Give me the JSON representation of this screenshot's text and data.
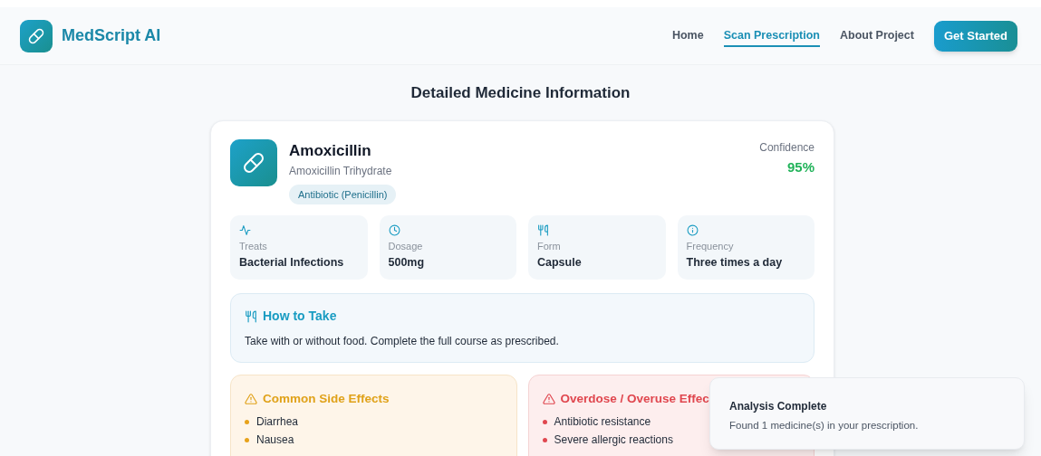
{
  "brand": {
    "name": "MedScript AI"
  },
  "nav": [
    {
      "label": "Home",
      "selected": false
    },
    {
      "label": "Scan Prescription",
      "selected": true
    },
    {
      "label": "About Project",
      "selected": false
    }
  ],
  "cta": "Get Started",
  "heading": "Detailed Medicine Information",
  "medicine": {
    "name": "Amoxicillin",
    "generic": "Amoxicillin Trihydrate",
    "category": "Antibiotic (Penicillin)",
    "confidence_label": "Confidence",
    "confidence": "95%",
    "stats": [
      {
        "kind": "activity",
        "label": "Treats",
        "value": "Bacterial Infections"
      },
      {
        "kind": "clock",
        "label": "Dosage",
        "value": "500mg"
      },
      {
        "kind": "utensils",
        "label": "Form",
        "value": "Capsule"
      },
      {
        "kind": "info",
        "label": "Frequency",
        "value": "Three times a day"
      }
    ],
    "how_to_take": {
      "title": "How to Take",
      "text": "Take with or without food. Complete the full course as prescribed."
    },
    "panels": [
      {
        "kind": "warning",
        "title": "Common Side Effects",
        "items": [
          "Diarrhea",
          "Nausea"
        ]
      },
      {
        "kind": "danger",
        "title": "Overdose / Overuse Effec",
        "items": [
          "Antibiotic resistance",
          "Severe allergic reactions"
        ]
      }
    ]
  },
  "toast": {
    "title": "Analysis Complete",
    "message": "Found 1 medicine(s) in your prescription."
  }
}
